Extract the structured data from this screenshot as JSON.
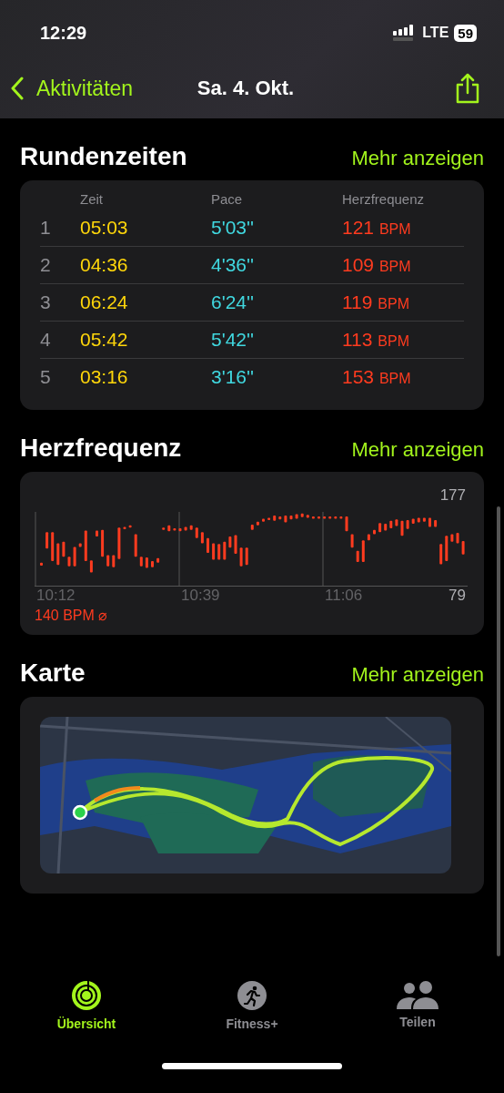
{
  "status_bar": {
    "time": "12:29",
    "network": "LTE",
    "battery": "59"
  },
  "nav": {
    "back": "Aktivitäten",
    "title": "Sa. 4. Okt."
  },
  "laps": {
    "title": "Rundenzeiten",
    "more": "Mehr anzeigen",
    "columns": [
      "Zeit",
      "Pace",
      "Herzfrequenz"
    ],
    "rows": [
      {
        "number": "1",
        "time": "05:03",
        "pace": "5'03''",
        "heart_rate": "121",
        "unit": "BPM"
      },
      {
        "number": "2",
        "time": "04:36",
        "pace": "4'36''",
        "heart_rate": "109",
        "unit": "BPM"
      },
      {
        "number": "3",
        "time": "06:24",
        "pace": "6'24''",
        "heart_rate": "119",
        "unit": "BPM"
      },
      {
        "number": "4",
        "time": "05:42",
        "pace": "5'42''",
        "heart_rate": "113",
        "unit": "BPM"
      },
      {
        "number": "5",
        "time": "03:16",
        "pace": "3'16''",
        "heart_rate": "153",
        "unit": "BPM"
      }
    ]
  },
  "heart_rate": {
    "title": "Herzfrequenz",
    "more": "Mehr anzeigen",
    "max": "177",
    "min": "79",
    "times": [
      "10:12",
      "10:39",
      "11:06"
    ],
    "average": "140 BPM ⌀"
  },
  "map": {
    "title": "Karte",
    "more": "Mehr anzeigen",
    "kind": "picture"
  },
  "tabs": [
    {
      "label": "Übersicht",
      "selected": true,
      "kind": "rings"
    },
    {
      "label": "Fitness+",
      "selected": false,
      "kind": "runner"
    },
    {
      "label": "Teilen",
      "selected": false,
      "kind": "people"
    }
  ]
}
